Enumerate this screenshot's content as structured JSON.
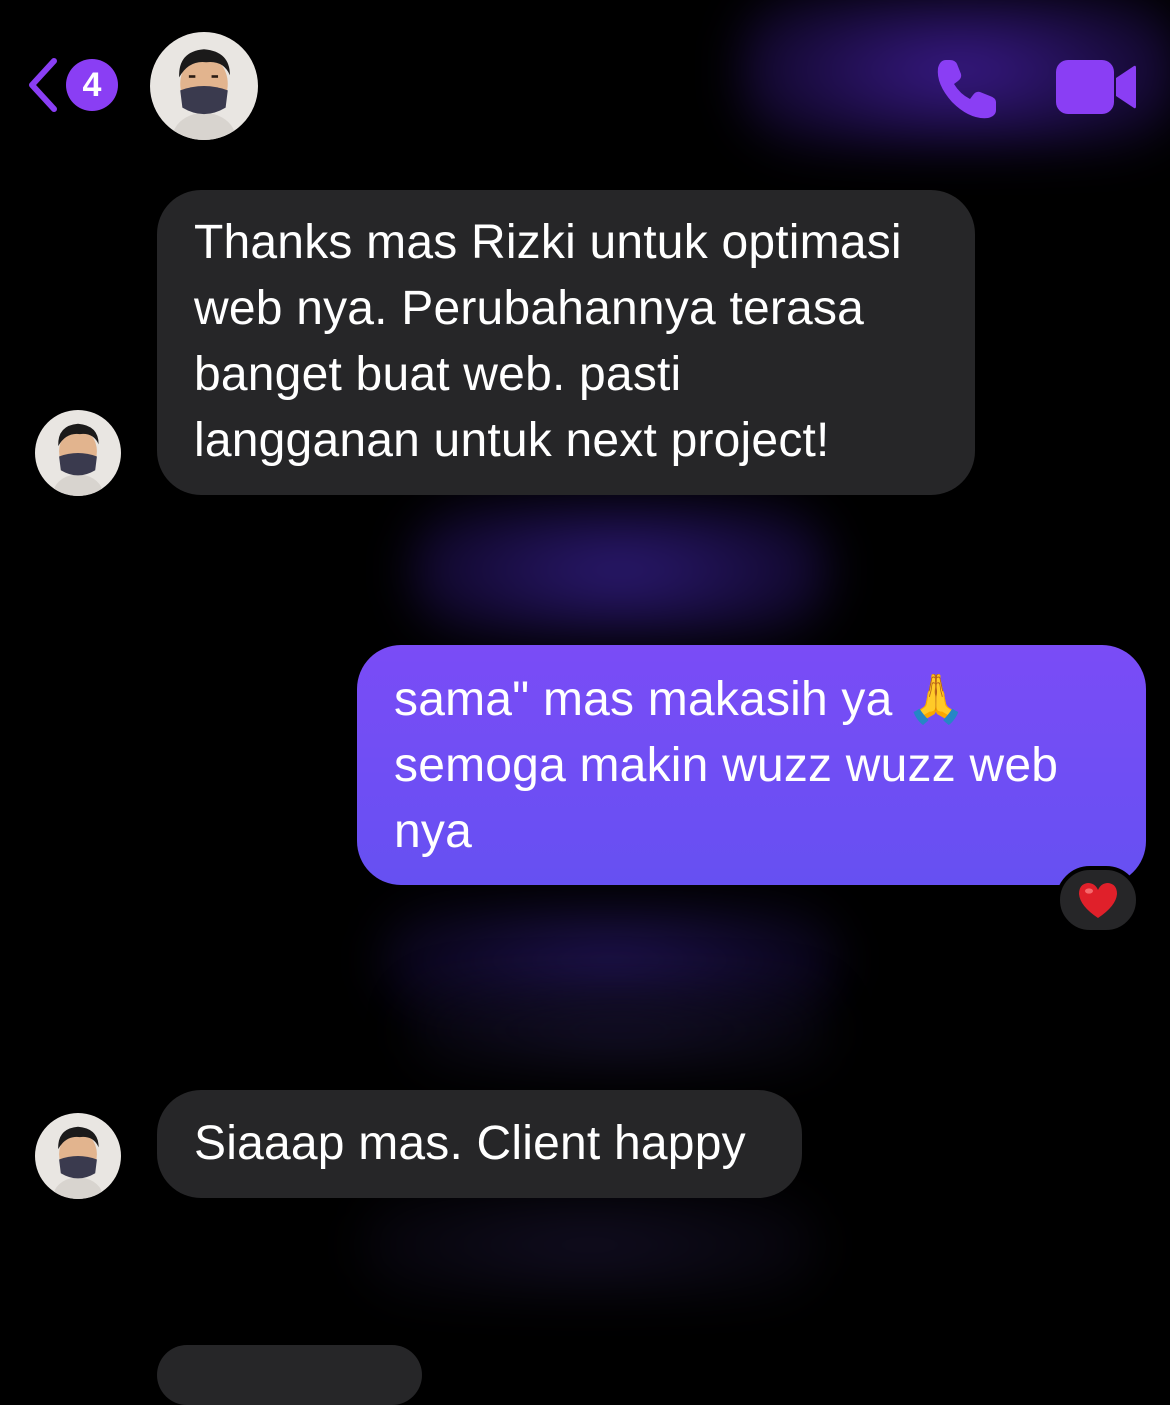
{
  "header": {
    "back_count": "4",
    "icons": {
      "back": "chevron-left-icon",
      "call": "phone-icon",
      "video": "video-camera-icon"
    }
  },
  "messages": [
    {
      "direction": "incoming",
      "lines": [
        "Thanks mas Rizki untuk optimasi",
        "web nya. Perubahannya terasa",
        "banget buat web. pasti",
        "langganan untuk next project!"
      ]
    },
    {
      "direction": "outgoing",
      "lines": [
        "sama\" mas makasih ya 🙏",
        "semoga makin wuzz wuzz web",
        "nya"
      ],
      "reaction": "heart-icon"
    },
    {
      "direction": "incoming",
      "lines": [
        "Siaaap mas. Client happy"
      ]
    }
  ],
  "colors": {
    "background": "#000000",
    "accent": "#8a3ef4",
    "incoming_bubble": "#262628",
    "outgoing_bubble": "#6d4ef4",
    "heart": "#e0202a"
  }
}
